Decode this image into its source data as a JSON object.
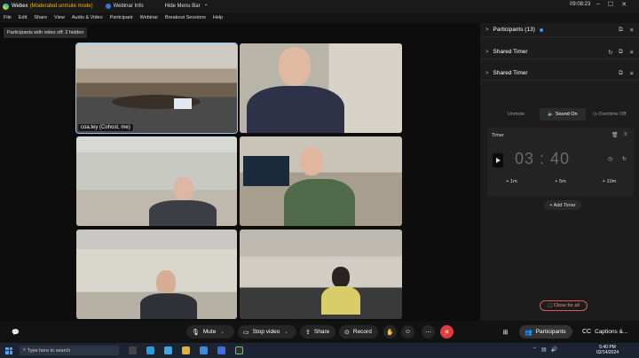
{
  "titlebar": {
    "app": "Webex",
    "mode": "(Moderated unmute mode)",
    "webinar_info": "Webinar Info",
    "hide_menu_bar": "Hide Menu Bar",
    "clock": "09:08:23"
  },
  "menu": [
    "File",
    "Edit",
    "Share",
    "View",
    "Audio & Video",
    "Participant",
    "Webinar",
    "Breakout Sessions",
    "Help"
  ],
  "notice": "Participants with video off: 2 hidden",
  "tiles": [
    {
      "label": "coa.tey (Cohost, me)"
    }
  ],
  "panel": {
    "participants": {
      "title": "Participants",
      "count": "(13)"
    },
    "shared_timer_collapsed": {
      "title": "Shared Timer"
    },
    "shared_timer": {
      "title": "Shared Timer",
      "toggle_unmute": "Unmute",
      "toggle_sound": "Sound On",
      "toggle_overtime": "Overtime Off",
      "timer_label": "Timer",
      "time": "03 : 40",
      "add_1m": "+ 1m",
      "add_5m": "+ 5m",
      "add_10m": "+ 10m",
      "add_timer": "+ Add Timer",
      "close_all": "Close for all"
    }
  },
  "toolbar": {
    "mute": "Mute",
    "stop_video": "Stop video",
    "share": "Share",
    "record": "Record",
    "participants": "Participants",
    "captions": "Captions &..."
  },
  "taskbar": {
    "search_placeholder": "Type here to search",
    "time": "5:40 PM",
    "date": "02/14/2024"
  },
  "colors": {
    "accent": "#3e8bff",
    "leave": "#e23b3b",
    "mode_warning": "#f4b400"
  }
}
